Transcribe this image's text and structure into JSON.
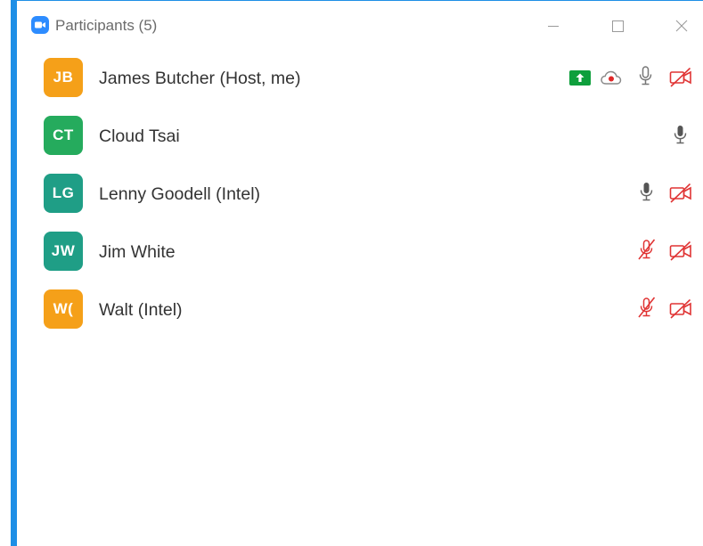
{
  "window": {
    "title": "Participants (5)",
    "accent_color": "#1e8fe6"
  },
  "participants": [
    {
      "initials": "JB",
      "name": "James Butcher (Host, me)",
      "avatar_color": "#f5a019",
      "status_icons": [
        "share-screen-icon",
        "cloud-recording-icon",
        "microphone-icon",
        "video-off-icon"
      ]
    },
    {
      "initials": "CT",
      "name": "Cloud Tsai",
      "avatar_color": "#25ab5d",
      "status_icons": [
        "microphone-icon"
      ]
    },
    {
      "initials": "LG",
      "name": "Lenny Goodell (Intel)",
      "avatar_color": "#1f9e86",
      "status_icons": [
        "microphone-icon",
        "video-off-icon"
      ]
    },
    {
      "initials": "JW",
      "name": "Jim White",
      "avatar_color": "#1f9e86",
      "status_icons": [
        "microphone-muted-icon",
        "video-off-icon"
      ]
    },
    {
      "initials": "W(",
      "name": "Walt (Intel)",
      "avatar_color": "#f5a019",
      "status_icons": [
        "microphone-muted-icon",
        "video-off-icon"
      ]
    }
  ]
}
